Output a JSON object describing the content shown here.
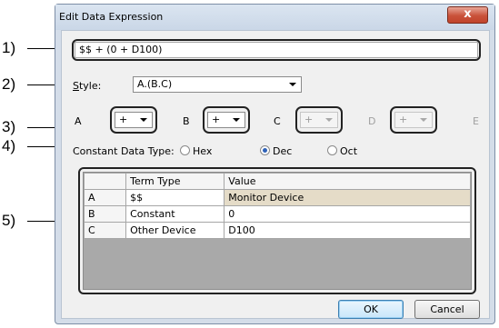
{
  "callouts": [
    "1)",
    "2)",
    "3)",
    "4)",
    "5)"
  ],
  "dialog": {
    "title": "Edit Data Expression",
    "close_glyph": "x"
  },
  "expression": {
    "value": "$$ + (0 + D100)"
  },
  "style": {
    "label": "Style:",
    "selected": "A.(B.C)"
  },
  "operators": [
    {
      "term": "A",
      "op": "+",
      "enabled": true
    },
    {
      "term": "B",
      "op": "+",
      "enabled": true
    },
    {
      "term": "C",
      "op": "+",
      "enabled": false
    },
    {
      "term": "D",
      "op": "+",
      "enabled": false
    },
    {
      "term": "E"
    }
  ],
  "constant_type": {
    "label": "Constant Data Type:",
    "options": [
      {
        "label": "Hex",
        "checked": false
      },
      {
        "label": "Dec",
        "checked": true
      },
      {
        "label": "Oct",
        "checked": false
      }
    ]
  },
  "grid": {
    "headers": [
      "",
      "Term Type",
      "Value"
    ],
    "rows": [
      {
        "id": "A",
        "term_type": "$$",
        "value": "Monitor Device",
        "selected": true
      },
      {
        "id": "B",
        "term_type": "Constant",
        "value": "0"
      },
      {
        "id": "C",
        "term_type": "Other Device",
        "value": "D100"
      }
    ]
  },
  "buttons": {
    "ok": "OK",
    "cancel": "Cancel"
  },
  "colors": {
    "selection": "#e5dcc8",
    "close": "#c9523a",
    "radio_dot": "#2f62b8"
  }
}
